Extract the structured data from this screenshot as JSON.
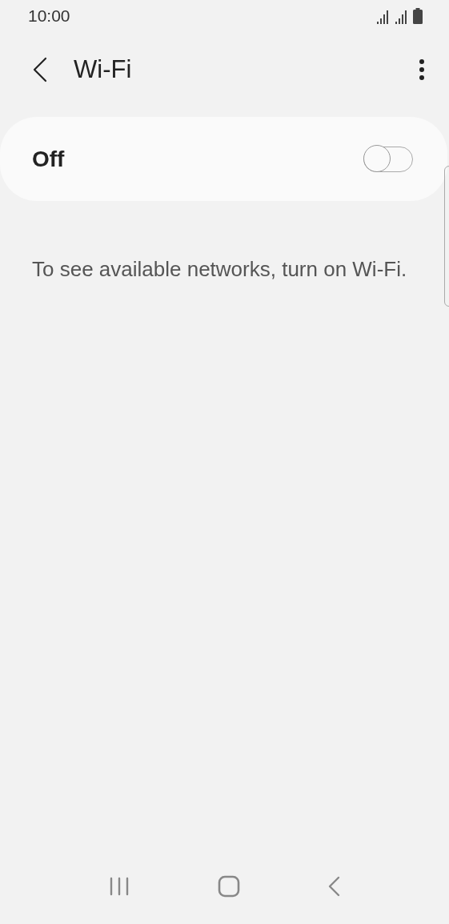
{
  "status_bar": {
    "time": "10:00"
  },
  "header": {
    "title": "Wi-Fi"
  },
  "wifi_switch": {
    "label": "Off",
    "on": false
  },
  "message": "To see available networks, turn on Wi-Fi."
}
